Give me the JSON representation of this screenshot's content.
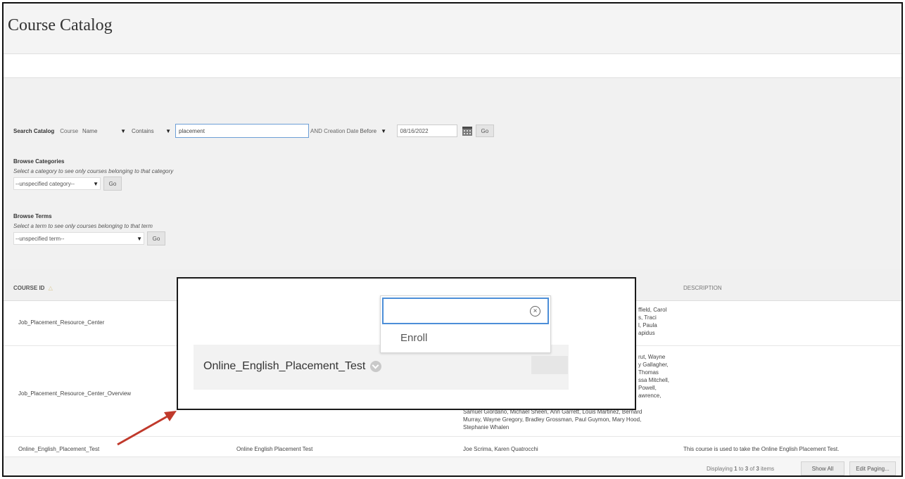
{
  "page": {
    "title": "Course Catalog"
  },
  "search": {
    "label": "Search Catalog",
    "field_label": "Course",
    "field_value": "Name",
    "operator_value": "Contains",
    "query_value": "placement",
    "date_label": "AND Creation Date",
    "date_operator_value": "Before",
    "date_value": "08/16/2022",
    "go_label": "Go"
  },
  "browse_categories": {
    "heading": "Browse Categories",
    "hint": "Select a category to see only courses belonging to that category",
    "selected": "--unspecified category--",
    "go_label": "Go"
  },
  "browse_terms": {
    "heading": "Browse Terms",
    "hint": "Select a term to see only courses belonging to that term",
    "selected": "--unspecified term--",
    "go_label": "Go"
  },
  "table": {
    "columns": {
      "course_id": "COURSE ID",
      "description": "DESCRIPTION"
    },
    "rows": [
      {
        "course_id": "Job_Placement_Resource_Center",
        "instructors_visible": [
          "ffield, Carol",
          "s, Traci",
          "l, Paula",
          "apidus"
        ]
      },
      {
        "course_id": "Job_Placement_Resource_Center_Overview",
        "instructors_visible": [
          "rut, Wayne",
          "y Gallagher,",
          "Thomas",
          "ssa Mitchell,",
          "Powell,",
          "awrence,",
          "Samuel Giordano, Michael Sheen, Ann Garrett, Louis Martinez, Bernard",
          "Murray, Wayne Gregory, Bradley Grossman, Paul Guymon, Mary Hood,",
          "Stephanie Whalen"
        ]
      },
      {
        "course_id": "Online_English_Placement_Test",
        "course_name": "Online English Placement Test",
        "instructors": "Joe Scrima, Karen Quatrocchi",
        "description": "This course is used to take the Online English Placement Test."
      }
    ],
    "footer": {
      "displaying_prefix": "Displaying",
      "from": "1",
      "to_word": "to",
      "to": "3",
      "of_word": "of",
      "total": "3",
      "items_word": "items",
      "show_all": "Show All",
      "edit_paging": "Edit Paging..."
    }
  },
  "callout": {
    "course_name": "Online_English_Placement_Test",
    "menu_item": "Enroll"
  },
  "colors": {
    "annotation_arrow": "#c0392b",
    "focus_border": "#4c8ed8"
  }
}
